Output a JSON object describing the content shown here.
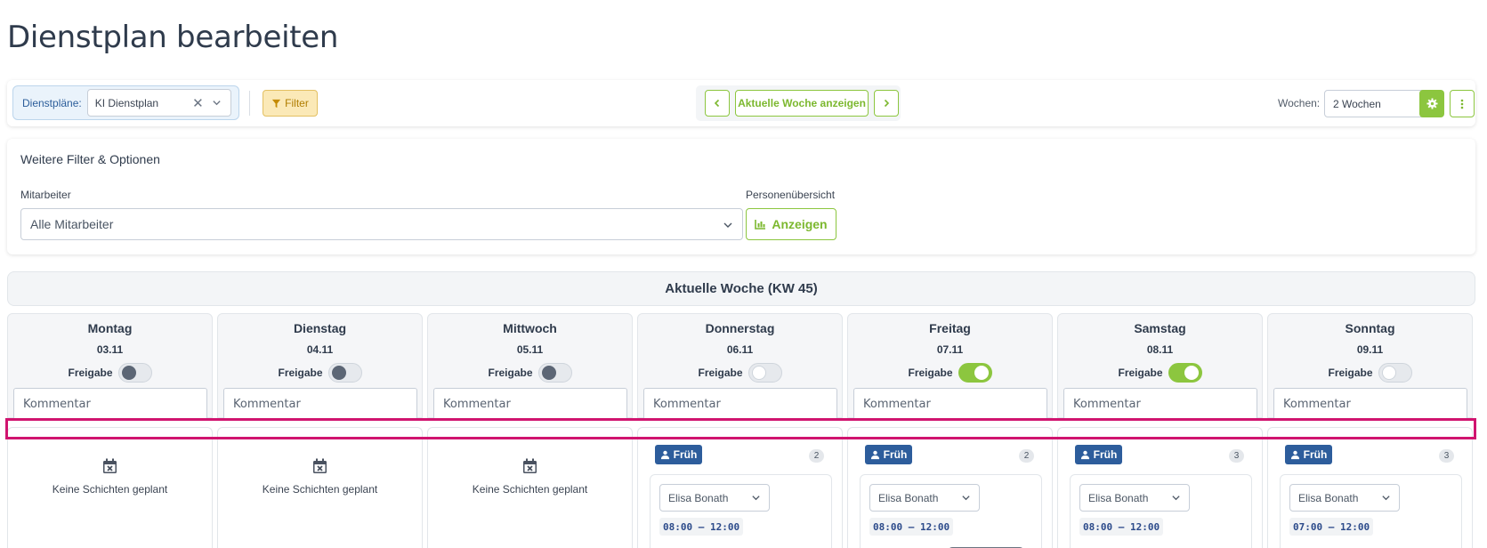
{
  "page": {
    "title": "Dienstplan bearbeiten"
  },
  "toolbar": {
    "dienstplaene_label": "Dienstpläne:",
    "dienstplan_value": "KI Dienstplan",
    "filter_label": "Filter",
    "current_week_label": "Aktuelle Woche anzeigen",
    "weeks_label": "Wochen:",
    "weeks_value": "2 Wochen"
  },
  "filter_panel": {
    "title": "Weitere Filter & Optionen",
    "mitarbeiter_label": "Mitarbeiter",
    "mitarbeiter_value": "Alle Mitarbeiter",
    "personen_label": "Personenübersicht",
    "anzeigen_label": "Anzeigen"
  },
  "week": {
    "header": "Aktuelle Woche (KW 45)"
  },
  "days": [
    {
      "name": "Montag",
      "date": "03.11",
      "freigabe_label": "Freigabe",
      "freigabe": false,
      "kommentar_placeholder": "Kommentar",
      "empty_text": "Keine Schichten geplant"
    },
    {
      "name": "Dienstag",
      "date": "04.11",
      "freigabe_label": "Freigabe",
      "freigabe": false,
      "kommentar_placeholder": "Kommentar",
      "empty_text": "Keine Schichten geplant"
    },
    {
      "name": "Mittwoch",
      "date": "05.11",
      "freigabe_label": "Freigabe",
      "freigabe": false,
      "kommentar_placeholder": "Kommentar",
      "empty_text": "Keine Schichten geplant"
    },
    {
      "name": "Donnerstag",
      "date": "06.11",
      "freigabe_label": "Freigabe",
      "freigabe": false,
      "kommentar_placeholder": "Kommentar",
      "shift": {
        "label": "Früh",
        "count": "2",
        "employee": "Elisa Bonath",
        "time": "08:00 – 12:00"
      }
    },
    {
      "name": "Freitag",
      "date": "07.11",
      "freigabe_label": "Freigabe",
      "freigabe": true,
      "kommentar_placeholder": "Kommentar",
      "shift": {
        "label": "Früh",
        "count": "2",
        "employee": "Elisa Bonath",
        "time": "08:00 – 12:00"
      }
    },
    {
      "name": "Samstag",
      "date": "08.11",
      "freigabe_label": "Freigabe",
      "freigabe": true,
      "kommentar_placeholder": "Kommentar",
      "shift": {
        "label": "Früh",
        "count": "3",
        "employee": "Elisa Bonath",
        "time": "08:00 – 12:00"
      }
    },
    {
      "name": "Sonntag",
      "date": "09.11",
      "freigabe_label": "Freigabe",
      "freigabe": false,
      "kommentar_placeholder": "Kommentar",
      "shift": {
        "label": "Früh",
        "count": "3",
        "employee": "Elisa Bonath",
        "time": "07:00 – 12:00"
      }
    }
  ],
  "colors": {
    "accent": "#8cc63f",
    "shift_badge": "#2d5d9c",
    "highlight": "#d0146f",
    "filter": "#fbe9b7"
  }
}
